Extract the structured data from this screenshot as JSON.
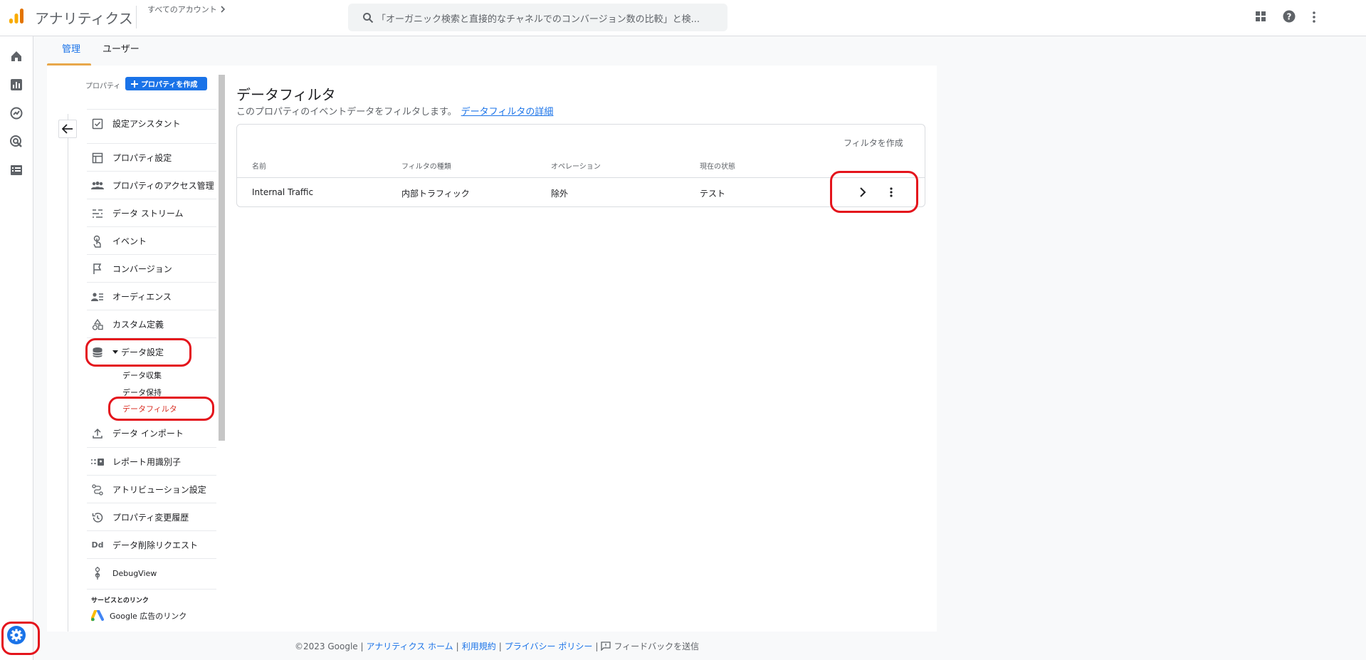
{
  "header": {
    "app_title": "アナリティクス",
    "account_crumb": "すべてのアカウント",
    "search_placeholder": "「オーガニック検索と直接的なチャネルでのコンバージョン数の比較」と検..."
  },
  "tabs": [
    {
      "label": "管理",
      "active": true
    },
    {
      "label": "ユーザー",
      "active": false
    }
  ],
  "nav": {
    "property_label": "プロパティ",
    "create_property": "プロパティを作成",
    "items": [
      {
        "label": "設定アシスタント",
        "icon": "checkbox-icon"
      },
      {
        "label": "プロパティ設定",
        "icon": "property-settings-icon"
      },
      {
        "label": "プロパティのアクセス管理",
        "icon": "people-icon"
      },
      {
        "label": "データ ストリーム",
        "icon": "stream-icon"
      },
      {
        "label": "イベント",
        "icon": "touch-icon"
      },
      {
        "label": "コンバージョン",
        "icon": "flag-icon"
      },
      {
        "label": "オーディエンス",
        "icon": "audience-icon"
      },
      {
        "label": "カスタム定義",
        "icon": "shapes-icon"
      },
      {
        "label": "データ設定",
        "icon": "database-icon"
      },
      {
        "label": "データ インポート",
        "icon": "upload-icon"
      },
      {
        "label": "レポート用識別子",
        "icon": "identifier-icon"
      },
      {
        "label": "アトリビューション設定",
        "icon": "attribution-icon"
      },
      {
        "label": "プロパティ変更履歴",
        "icon": "history-icon"
      },
      {
        "label": "データ削除リクエスト",
        "icon": "dd-icon"
      },
      {
        "label": "DebugView",
        "icon": "debug-icon"
      }
    ],
    "sub_items": [
      "データ収集",
      "データ保持",
      "データフィルタ"
    ],
    "link_section": "サービスとのリンク",
    "google_ads_link": "Google 広告のリンク",
    "dd_glyph": "Dd"
  },
  "content": {
    "title": "データフィルタ",
    "description": "このプロパティのイベントデータをフィルタします。",
    "detail_link": "データフィルタの詳細",
    "create_filter": "フィルタを作成",
    "columns": [
      "名前",
      "フィルタの種類",
      "オペレーション",
      "現在の状態"
    ],
    "rows": [
      {
        "name": "Internal Traffic",
        "type": "内部トラフィック",
        "operation": "除外",
        "status": "テスト"
      }
    ]
  },
  "footer": {
    "copyright": "©2023 Google |",
    "home": "アナリティクス ホーム",
    "sep1": "|",
    "terms": "利用規約",
    "sep2": "|",
    "privacy": "プライバシー ポリシー",
    "sep3": "|",
    "feedback": "フィードバックを送信"
  },
  "colors": {
    "accent": "#1a73e8",
    "active_sub": "#d93025",
    "annotation": "#e4141c",
    "tab_underline": "#e8a74a"
  }
}
